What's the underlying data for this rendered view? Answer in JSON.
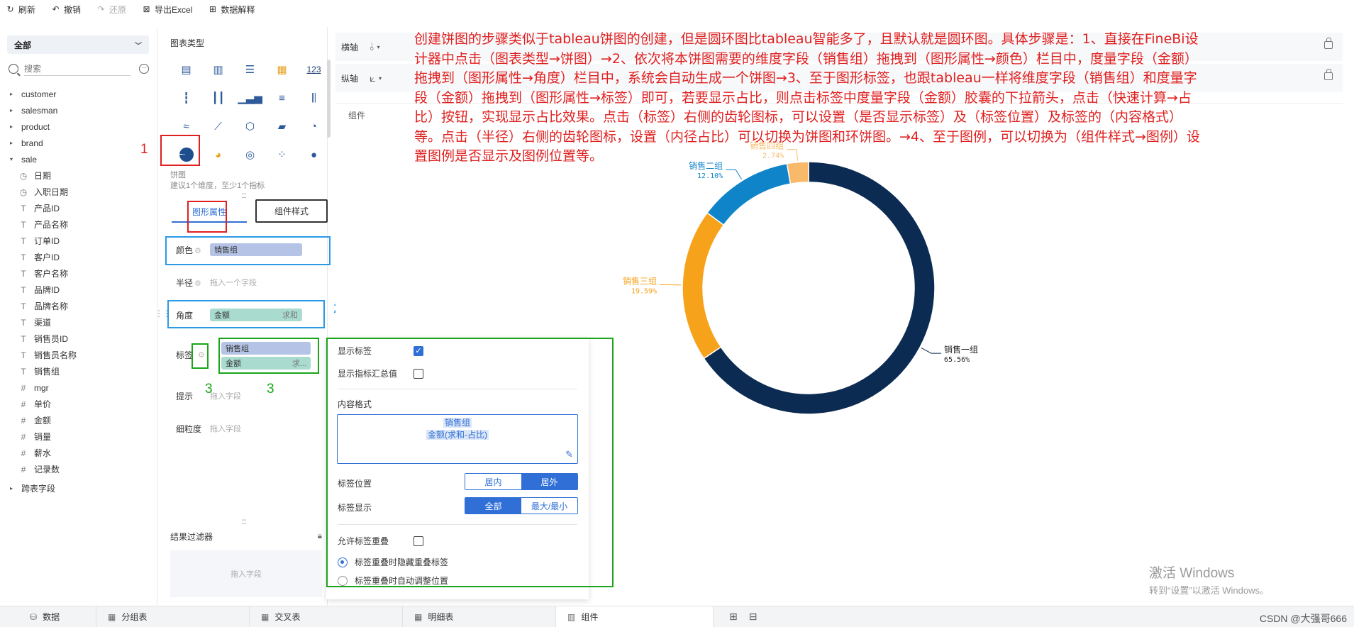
{
  "toolbar": {
    "refresh": "刷新",
    "undo": "撤销",
    "redo": "还原",
    "export": "导出Excel",
    "explain": "数据解释"
  },
  "fields": {
    "select_value": "全部",
    "search_placeholder": "搜索",
    "folders": [
      "customer",
      "salesman",
      "product",
      "brand",
      "sale"
    ],
    "sale_items": [
      {
        "type": "◷",
        "name": "日期"
      },
      {
        "type": "◷",
        "name": "入职日期"
      },
      {
        "type": "T",
        "name": "产品ID"
      },
      {
        "type": "T",
        "name": "产品名称"
      },
      {
        "type": "T",
        "name": "订单ID"
      },
      {
        "type": "T",
        "name": "客户ID"
      },
      {
        "type": "T",
        "name": "客户名称"
      },
      {
        "type": "T",
        "name": "品牌ID"
      },
      {
        "type": "T",
        "name": "品牌名称"
      },
      {
        "type": "T",
        "name": "渠道"
      },
      {
        "type": "T",
        "name": "销售员ID"
      },
      {
        "type": "T",
        "name": "销售员名称"
      },
      {
        "type": "T",
        "name": "销售组"
      },
      {
        "type": "#",
        "name": "mgr"
      },
      {
        "type": "#",
        "name": "单价"
      },
      {
        "type": "#",
        "name": "金额"
      },
      {
        "type": "#",
        "name": "销量"
      },
      {
        "type": "#",
        "name": "薪水"
      },
      {
        "type": "#",
        "name": "记录数"
      }
    ],
    "cross_table": "跨表字段"
  },
  "chart_type": {
    "title": "图表类型",
    "selected_name": "饼图",
    "hint": "建议1个维度，至少1个指标",
    "number_icon": "123"
  },
  "tabs": {
    "attr": "图形属性",
    "style": "组件样式"
  },
  "attrs": {
    "color_label": "颜色",
    "color_value": "销售组",
    "radius_label": "半径",
    "radius_placeholder": "拖入一个字段",
    "angle_label": "角度",
    "angle_value": "金额",
    "angle_agg": "求和",
    "label_label": "标签",
    "label_value1": "销售组",
    "label_value2": "金额",
    "label_agg": "求...",
    "tip_label": "提示",
    "tip_placeholder": "拖入字段",
    "grain_label": "细粒度",
    "grain_placeholder": "拖入字段"
  },
  "filter": {
    "title": "结果过滤器",
    "placeholder": "拖入字段"
  },
  "axes": {
    "x_label": "横轴",
    "y_label": "纵轴"
  },
  "annotation": {
    "n1": "1",
    "n2a": "2",
    "n2b": "2",
    "n3a": "3",
    "n3b": "3",
    "n4": "4",
    "text": "创建饼图的步骤类似于tableau饼图的创建，但是圆环图比tableau智能多了，且默认就是圆环图。具体步骤是：1、直接在FineBi设计器中点击（图表类型→饼图）→2、依次将本饼图需要的维度字段（销售组）拖拽到（图形属性→颜色）栏目中，度量字段（金额）拖拽到（图形属性→角度）栏目中，系统会自动生成一个饼图→3、至于图形标签，也跟tableau一样将维度字段（销售组）和度量字段（金额）拖拽到（图形属性→标签）即可，若要显示占比，则点击标签中度量字段（金额）胶囊的下拉箭头，点击（快速计算→占比）按钮，实现显示占比效果。点击（标签）右侧的齿轮图标，可以设置（是否显示标签）及（标签位置）及标签的（内容格式）等。点击（半径）右侧的齿轮图标，设置（内径占比）可以切换为饼图和环饼图。→4、至于图例，可以切换为（组件样式→图例）设置图例是否显示及图例位置等。"
  },
  "canvas": {
    "title": "组件"
  },
  "chart_data": {
    "type": "pie",
    "donut": true,
    "categories": [
      "销售一组",
      "销售二组",
      "销售三组",
      "销售四组"
    ],
    "values": [
      65.56,
      12.1,
      19.59,
      2.74
    ],
    "value_labels": [
      "65.56%",
      "12.10%",
      "19.59%",
      "2.74%"
    ],
    "colors": [
      "#0c2b52",
      "#0f84c9",
      "#f7a21b",
      "#f8ba6a"
    ],
    "slice_order": [
      0,
      2,
      1,
      3
    ],
    "label_colors": [
      "#222222",
      "#0f84c9",
      "#f7a21b",
      "#f8ba6a"
    ],
    "label_position": "outside"
  },
  "popup": {
    "show_label": "显示标签",
    "show_label_checked": true,
    "show_total": "显示指标汇总值",
    "show_total_checked": false,
    "content_format": "内容格式",
    "format_line1": "销售组",
    "format_line2": "金额(求和-占比)",
    "label_position": "标签位置",
    "pos_inside": "居内",
    "pos_outside": "居外",
    "label_display": "标签显示",
    "display_all": "全部",
    "display_maxmin": "最大/最小",
    "allow_overlap": "允许标签重叠",
    "overlap_hide": "标签重叠时隐藏重叠标签",
    "overlap_adjust": "标签重叠时自动调整位置"
  },
  "bottom_tabs": {
    "data": "数据",
    "group_table": "分组表",
    "cross_table": "交叉表",
    "detail_table": "明细表",
    "component": "组件"
  },
  "watermark": {
    "line1": "激活 Windows",
    "line2": "转到“设置”以激活 Windows。",
    "csdn": "CSDN @大强哥666"
  }
}
